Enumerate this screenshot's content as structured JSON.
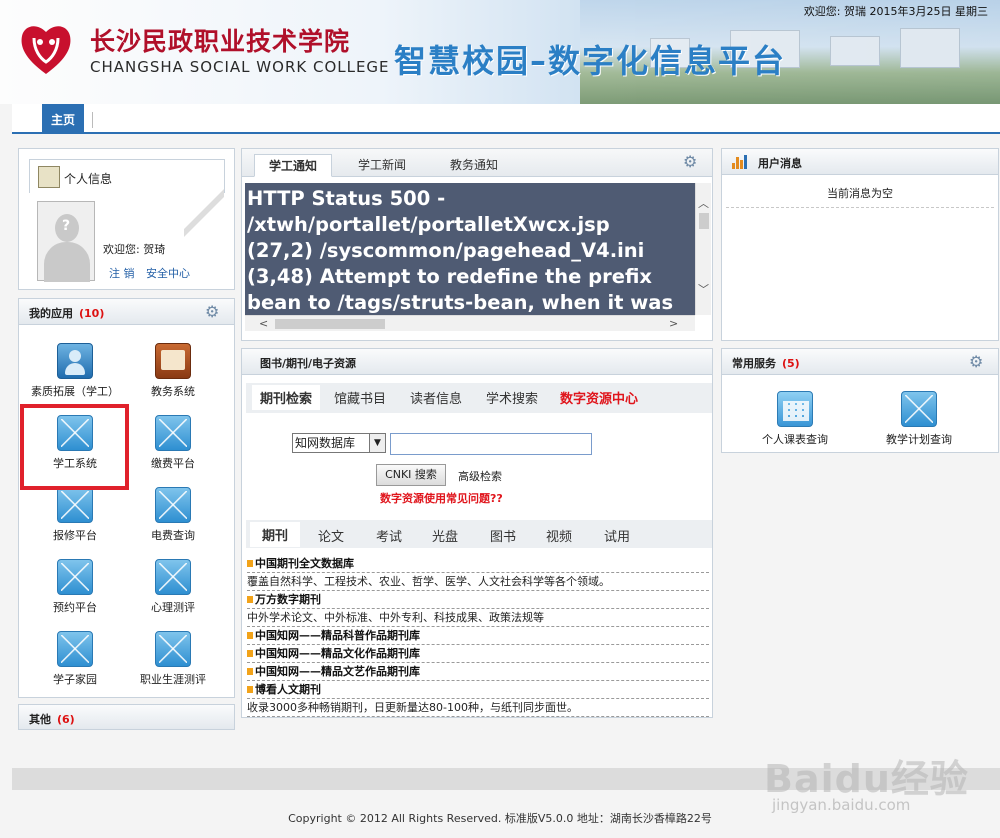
{
  "header": {
    "school_cn": "长沙民政职业技术学院",
    "school_en": "CHANGSHA SOCIAL WORK COLLEGE",
    "platform_title": "智慧校园–数字化信息平台",
    "welcome": "欢迎您: 贺瑞 2015年3月25日 星期三",
    "brand_color": "#b0102a",
    "platform_color": "#2b7fc5"
  },
  "nav": {
    "home": "主页"
  },
  "personal_info": {
    "title": "个人信息",
    "welcome": "欢迎您: 贺琦",
    "logout": "注 销",
    "security": "安全中心"
  },
  "my_apps": {
    "title": "我的应用",
    "count": "(10)",
    "items": [
      {
        "label": "素质拓展（学工）",
        "icon": "person-card-icon"
      },
      {
        "label": "教务系统",
        "icon": "book-icon"
      },
      {
        "label": "学工系统",
        "icon": "mail-icon"
      },
      {
        "label": "缴费平台",
        "icon": "mail-icon"
      },
      {
        "label": "报修平台",
        "icon": "mail-icon"
      },
      {
        "label": "电费查询",
        "icon": "mail-icon"
      },
      {
        "label": "预约平台",
        "icon": "mail-icon"
      },
      {
        "label": "心理测评",
        "icon": "mail-icon"
      },
      {
        "label": "学子家园",
        "icon": "mail-icon"
      },
      {
        "label": "职业生涯测评",
        "icon": "mail-icon"
      }
    ]
  },
  "other": {
    "title": "其他",
    "count": "(6)"
  },
  "notices": {
    "tabs": [
      "学工通知",
      "学工新闻",
      "教务通知"
    ],
    "error_text": "HTTP Status 500 -\n/xtwh/portallet/portalletXwcx.jsp\n(27,2) /syscommon/pagehead_V4.ini\n(3,48) Attempt to redefine the prefix\nbean to /tags/struts-bean, when it was"
  },
  "user_messages": {
    "title": "用户消息",
    "empty": "当前消息为空"
  },
  "library": {
    "title": "图书/期刊/电子资源",
    "tabs": [
      "期刊检索",
      "馆藏书目",
      "读者信息",
      "学术搜索",
      "数字资源中心"
    ],
    "db_select": "知网数据库",
    "search_value": "",
    "search_button": "CNKI 搜索",
    "advanced": "高级检索",
    "faq": "数字资源使用常见问题??",
    "categories": [
      "期刊",
      "论文",
      "考试",
      "光盘",
      "图书",
      "视频",
      "试用"
    ],
    "results": [
      {
        "kind": "title",
        "text": "中国期刊全文数据库"
      },
      {
        "kind": "desc",
        "text": "覆盖自然科学、工程技术、农业、哲学、医学、人文社会科学等各个领域。"
      },
      {
        "kind": "title",
        "text": "万方数字期刊"
      },
      {
        "kind": "desc",
        "text": "中外学术论文、中外标准、中外专利、科技成果、政策法规等"
      },
      {
        "kind": "title",
        "text": "中国知网——精品科普作品期刊库"
      },
      {
        "kind": "title",
        "text": "中国知网——精品文化作品期刊库"
      },
      {
        "kind": "title",
        "text": "中国知网——精品文艺作品期刊库"
      },
      {
        "kind": "title",
        "text": "博看人文期刊"
      },
      {
        "kind": "desc",
        "text": "收录3000多种畅销期刊，日更新量达80-100种，与纸刊同步面世。"
      }
    ]
  },
  "services": {
    "title": "常用服务",
    "count": "(5)",
    "items": [
      {
        "label": "个人课表查询",
        "icon": "calendar-icon"
      },
      {
        "label": "教学计划查询",
        "icon": "mail-icon"
      }
    ]
  },
  "footer": {
    "copyright": "Copyright © 2012  All Rights Reserved. 标准版V5.0.0  地址：湖南长沙香樟路22号",
    "watermark": "Baidu经验",
    "watermark_sub": "jingyan.baidu.com"
  }
}
